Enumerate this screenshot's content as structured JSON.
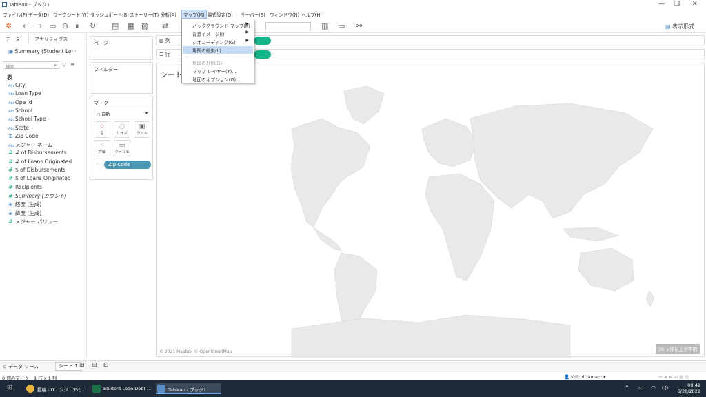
{
  "window": {
    "title": "Tableau - ブック1",
    "controls": [
      "—",
      "❐",
      "✕"
    ]
  },
  "menubar": [
    "ファイル(F)",
    "データ(D)",
    "ワークシート(W)",
    "ダッシュボード(B)",
    "ストーリー(T)",
    "分析(A)",
    "マップ(M)",
    "書式設定(O)",
    "サーバー(S)",
    "ウィンドウ(N)",
    "ヘルプ(H)"
  ],
  "map_menu": {
    "items": [
      {
        "label": "バックグラウンド マップ(K)",
        "submenu": true
      },
      {
        "label": "背景イメージ(I)",
        "submenu": true
      },
      {
        "label": "ジオコーディング(G)",
        "submenu": true
      },
      {
        "label": "場所の編集(L)...",
        "highlighted": true
      },
      {
        "label": "地図の凡例(G)",
        "disabled": true
      },
      {
        "label": "マップ レイヤー(Y)..."
      },
      {
        "label": "地図のオプション(O)..."
      }
    ]
  },
  "toolbar": {
    "show_me": "表示形式"
  },
  "data_pane": {
    "tabs": [
      "データ",
      "アナリティクス"
    ],
    "data_source": "Summary (Student Lo···",
    "search_placeholder": "検索",
    "tables_header": "表",
    "fields": [
      {
        "type": "Abc",
        "name": "City"
      },
      {
        "type": "Abc",
        "name": "Loan Type"
      },
      {
        "type": "Abc",
        "name": "Ope Id"
      },
      {
        "type": "Abc",
        "name": "School"
      },
      {
        "type": "Abc",
        "name": "School Type"
      },
      {
        "type": "Abc",
        "name": "State"
      },
      {
        "type": "geo",
        "name": "Zip Code"
      },
      {
        "type": "Abc",
        "name": "メジャー ネーム"
      },
      {
        "type": "#",
        "name": "# of Disbursements"
      },
      {
        "type": "#",
        "name": "# of Loans Originated"
      },
      {
        "type": "#",
        "name": "$ of Disbursements"
      },
      {
        "type": "#",
        "name": "$ of Loans Originated"
      },
      {
        "type": "#",
        "name": "Recipients"
      },
      {
        "type": "#",
        "name": "Summary (カウント)",
        "italic": true
      },
      {
        "type": "geo",
        "name": "経度 (生成)"
      },
      {
        "type": "geo",
        "name": "緯度 (生成)"
      },
      {
        "type": "#",
        "name": "メジャー バリュー"
      }
    ]
  },
  "cards": {
    "pages": "ページ",
    "filters": "フィルター",
    "marks": "マーク",
    "marks_type": "自動",
    "buttons": [
      "色",
      "サイズ",
      "ラベル",
      "詳細",
      "ツールヒ···"
    ],
    "pill": "Zip Code"
  },
  "shelves": {
    "columns": "列",
    "rows": "行"
  },
  "view": {
    "sheet_title": "シート",
    "attribution": "© 2021 Mapbox © OpenStreetMap",
    "unknown_badge": "3K ヶ所以上が不明"
  },
  "sheet_tabs": [
    "データ ソース",
    "シート 1"
  ],
  "status": {
    "marks": "0 個のマーク",
    "rows_cols": "1 行 x 1 列",
    "user": "Koichi Yama···"
  },
  "taskbar": {
    "apps": [
      "投稿 - ITエンジニアの...",
      "Student Loan Debt ...",
      "Tableau - ブック1"
    ],
    "time": "00:42",
    "date": "6/28/2021"
  }
}
